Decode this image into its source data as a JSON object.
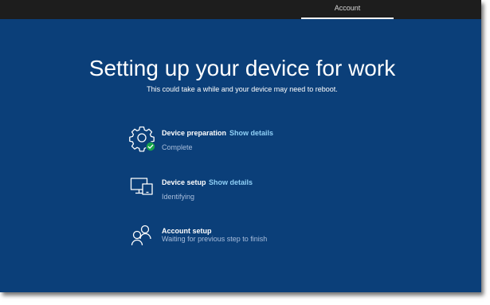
{
  "header": {
    "tab_label": "Account"
  },
  "page": {
    "title": "Setting up your device for work",
    "subtitle": "This could take a while and your device may need to reboot."
  },
  "steps": [
    {
      "name": "Device preparation",
      "link": "Show details",
      "status": "Complete",
      "icon": "gear-icon"
    },
    {
      "name": "Device setup",
      "link": "Show details",
      "status": "Identifying",
      "icon": "device-icon"
    },
    {
      "name": "Account setup",
      "status": "Waiting for previous step to finish",
      "icon": "people-icon"
    }
  ],
  "colors": {
    "background": "#0b3f79",
    "topbar": "#1d1d1d",
    "link": "#8fd0f7",
    "status_text": "#a9bedc",
    "success": "#16a34a"
  }
}
